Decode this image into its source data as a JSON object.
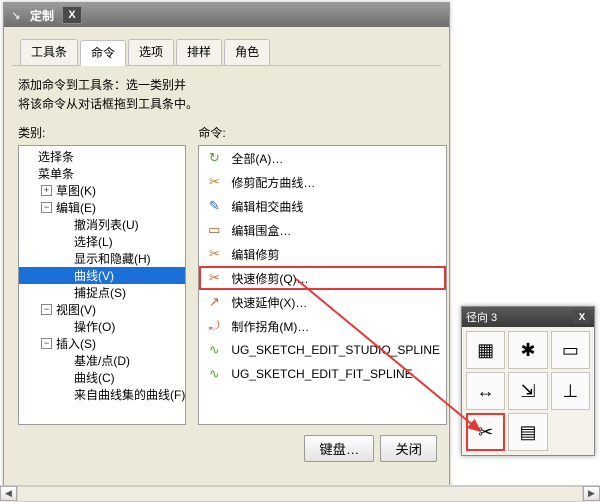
{
  "window": {
    "title": "定制",
    "tabs": [
      "工具条",
      "命令",
      "选项",
      "排样",
      "角色"
    ],
    "active_tab_index": 1,
    "help_line1": "添加命令到工具条：选一类别并",
    "help_line2": "将该命令从对话框拖到工具条中。"
  },
  "category": {
    "label": "类别:",
    "items": [
      {
        "text": "选择条",
        "depth": 0,
        "toggle": ""
      },
      {
        "text": "菜单条",
        "depth": 0,
        "toggle": ""
      },
      {
        "text": "草图(K)",
        "depth": 1,
        "toggle": "+"
      },
      {
        "text": "编辑(E)",
        "depth": 1,
        "toggle": "-"
      },
      {
        "text": "撤消列表(U)",
        "depth": 2,
        "toggle": ""
      },
      {
        "text": "选择(L)",
        "depth": 2,
        "toggle": ""
      },
      {
        "text": "显示和隐藏(H)",
        "depth": 2,
        "toggle": ""
      },
      {
        "text": "曲线(V)",
        "depth": 2,
        "toggle": "",
        "selected": true
      },
      {
        "text": "捕捉点(S)",
        "depth": 2,
        "toggle": ""
      },
      {
        "text": "视图(V)",
        "depth": 1,
        "toggle": "-"
      },
      {
        "text": "操作(O)",
        "depth": 2,
        "toggle": ""
      },
      {
        "text": "插入(S)",
        "depth": 1,
        "toggle": "-"
      },
      {
        "text": "基准/点(D)",
        "depth": 2,
        "toggle": ""
      },
      {
        "text": "曲线(C)",
        "depth": 2,
        "toggle": ""
      },
      {
        "text": "来自曲线集的曲线(F)",
        "depth": 2,
        "toggle": ""
      }
    ]
  },
  "commands": {
    "label": "命令:",
    "items": [
      {
        "text": "全部(A)…",
        "icon": "↻",
        "color": "#5aa02c"
      },
      {
        "text": "修剪配方曲线…",
        "icon": "✂",
        "color": "#c07a2a"
      },
      {
        "text": "编辑相交曲线",
        "icon": "✎",
        "color": "#2a6bb0"
      },
      {
        "text": "编辑围盒…",
        "icon": "▭",
        "color": "#b05a2a"
      },
      {
        "text": "编辑修剪",
        "icon": "✂",
        "color": "#c07a2a"
      },
      {
        "text": "快速修剪(Q)…",
        "icon": "✂",
        "color": "#d0602a",
        "highlight": true
      },
      {
        "text": "快速延伸(X)…",
        "icon": "↗",
        "color": "#d0602a"
      },
      {
        "text": "制作拐角(M)…",
        "icon": "⤾",
        "color": "#d0602a"
      },
      {
        "text": "UG_SKETCH_EDIT_STUDIO_SPLINE",
        "icon": "∿",
        "color": "#5aa02c"
      },
      {
        "text": "UG_SKETCH_EDIT_FIT_SPLINE",
        "icon": "∿",
        "color": "#5aa02c"
      }
    ]
  },
  "buttons": {
    "keyboard": "键盘…",
    "close": "关闭"
  },
  "palette": {
    "title": "径向 3",
    "cells": [
      {
        "icon": "▦",
        "name": "grid-icon"
      },
      {
        "icon": "✱",
        "name": "constraint-icon"
      },
      {
        "icon": "▭",
        "name": "rectangle-icon"
      },
      {
        "icon": "↔",
        "name": "dimension-icon"
      },
      {
        "icon": "⇲",
        "name": "corner-icon"
      },
      {
        "icon": "⊥",
        "name": "perpendicular-icon"
      },
      {
        "icon": "✂",
        "name": "trim-icon",
        "highlight": true
      },
      {
        "icon": "▤",
        "name": "sheet-icon"
      },
      {
        "icon": "",
        "name": "",
        "empty": true
      }
    ]
  }
}
